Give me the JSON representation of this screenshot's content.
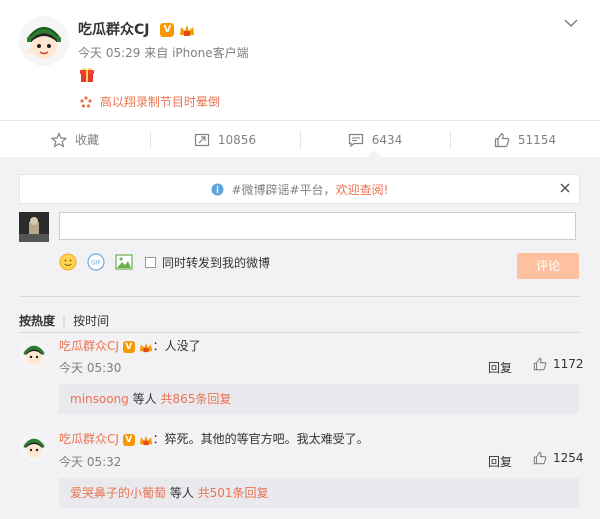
{
  "post": {
    "author": "吃瓜群众CJ",
    "verified_badge": "V",
    "time": "今天 05:29",
    "source_prefix": "来自",
    "source": "iPhone客户端",
    "topic_link": "高以翔录制节目时晕倒"
  },
  "actions": {
    "favorite": "收藏",
    "repost": "10856",
    "comment": "6434",
    "like": "51154"
  },
  "notice": {
    "tag": "#微博辟谣#平台，",
    "link": "欢迎查阅!"
  },
  "composer": {
    "placeholder": "",
    "repost_option": "同时转发到我的微博",
    "submit": "评论"
  },
  "sort": {
    "hot": "按热度",
    "time": "按时间"
  },
  "comments": [
    {
      "user": "吃瓜群众CJ",
      "text": "：人没了",
      "time": "今天 05:30",
      "reply_label": "回复",
      "likes": "1172",
      "sub_user": "minsoong",
      "sub_mid": " 等人 ",
      "sub_count": "共865条回复"
    },
    {
      "user": "吃瓜群众CJ",
      "text": "：猝死。其他的等官方吧。我太难受了。",
      "time": "今天 05:32",
      "reply_label": "回复",
      "likes": "1254",
      "sub_user": "爱哭鼻子的小葡萄",
      "sub_mid": " 等人 ",
      "sub_count": "共501条回复"
    }
  ],
  "colors": {
    "accent": "#eb7350",
    "gray_text": "#808080",
    "panel_bg": "#f2f2f5",
    "submit_bg": "#ffc09f"
  }
}
